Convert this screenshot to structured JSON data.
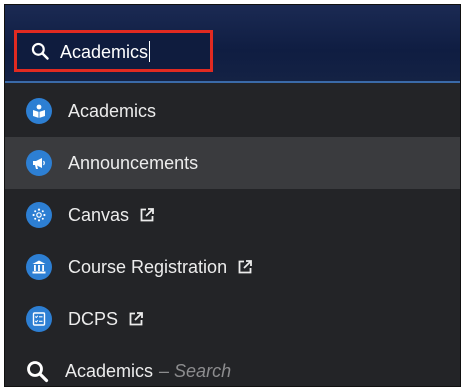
{
  "search": {
    "value": "Academics",
    "border_color": "#e02a21"
  },
  "results": [
    {
      "label": "Academics",
      "icon": "academics-icon",
      "external": false
    },
    {
      "label": "Announcements",
      "icon": "megaphone-icon",
      "external": false,
      "highlighted": true
    },
    {
      "label": "Canvas",
      "icon": "canvas-icon",
      "external": true
    },
    {
      "label": "Course Registration",
      "icon": "institution-icon",
      "external": true
    },
    {
      "label": "DCPS",
      "icon": "checklist-icon",
      "external": true
    }
  ],
  "search_suggestion": {
    "query": "Academics",
    "suffix": "– Search",
    "icon": "search-icon"
  },
  "colors": {
    "accent": "#2d7fd3",
    "panel": "#232427",
    "highlight": "#3a3b3e",
    "header": "#0f1d42"
  }
}
